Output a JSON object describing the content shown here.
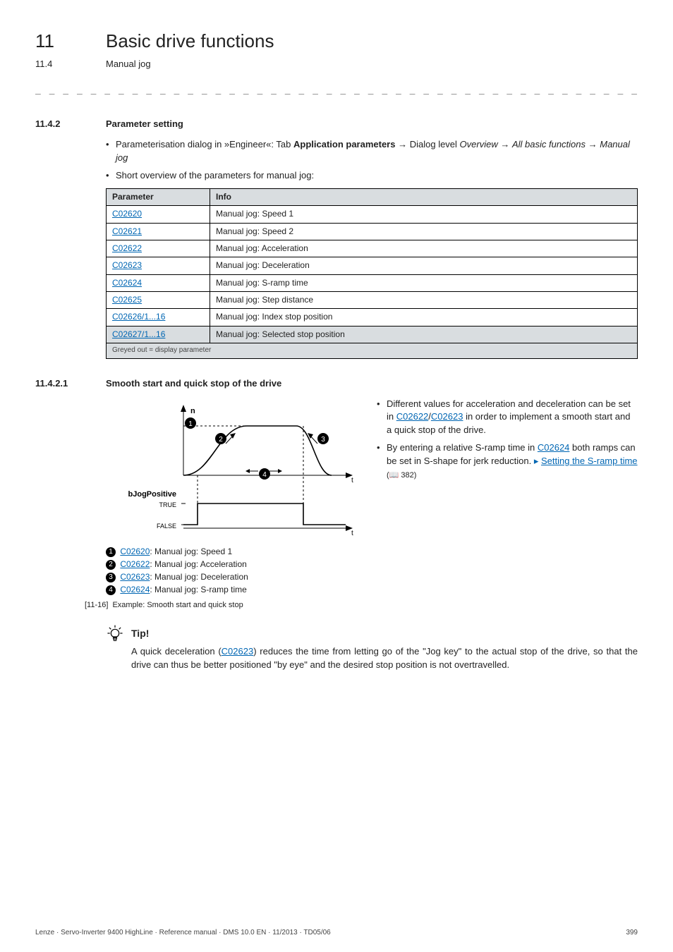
{
  "header": {
    "chapnum": "11",
    "chaptitle": "Basic drive functions",
    "subnum": "11.4",
    "subtitle": "Manual jog"
  },
  "dashline": "_ _ _ _ _ _ _ _ _ _ _ _ _ _ _ _ _ _ _ _ _ _ _ _ _ _ _ _ _ _ _ _ _ _ _ _ _ _ _ _ _ _ _ _ _ _ _ _ _ _ _ _ _ _ _ _ _ _ _ _ _ _ _ _",
  "sec1": {
    "num": "11.4.2",
    "title": "Parameter setting",
    "bullet1a": "Parameterisation dialog in »Engineer«: Tab ",
    "bullet1b": "Application parameters",
    "bullet1c": " Dialog level ",
    "bullet1d": "Overview ",
    "bullet1e": "All basic functions ",
    "bullet1f": " Manual jog",
    "bullet2": "Short overview of the parameters for manual jog:"
  },
  "table": {
    "h1": "Parameter",
    "h2": "Info",
    "rows": [
      {
        "p": "C02620",
        "i": "Manual jog: Speed 1"
      },
      {
        "p": "C02621",
        "i": "Manual jog: Speed 2"
      },
      {
        "p": "C02622",
        "i": "Manual jog: Acceleration"
      },
      {
        "p": "C02623",
        "i": "Manual jog: Deceleration"
      },
      {
        "p": "C02624",
        "i": "Manual jog: S-ramp time"
      },
      {
        "p": "C02625",
        "i": "Manual jog: Step distance"
      },
      {
        "p": "C02626/1...16",
        "i": "Manual jog: Index stop position"
      },
      {
        "p": "C02627/1...16",
        "i": "Manual jog: Selected stop position",
        "grey": true
      }
    ],
    "footnote": "Greyed out = display parameter"
  },
  "sec2": {
    "num": "11.4.2.1",
    "title": "Smooth start and quick stop of the drive"
  },
  "diagram": {
    "n": "n",
    "bJog": "bJogPositive",
    "true": "TRUE",
    "false": "FALSE",
    "t": "t"
  },
  "legend": {
    "l1": {
      "code": "C02620",
      "text": ": Manual jog: Speed 1"
    },
    "l2": {
      "code": "C02622",
      "text": ": Manual jog: Acceleration"
    },
    "l3": {
      "code": "C02623",
      "text": ": Manual jog: Deceleration"
    },
    "l4": {
      "code": "C02624",
      "text": ": Manual jog: S-ramp time"
    }
  },
  "caption": {
    "num": "[11-16]",
    "text": "Example: Smooth start and quick stop"
  },
  "notes": {
    "n1a": "Different values for acceleration and deceleration can be set in ",
    "n1b": "C02622",
    "n1c": "/",
    "n1d": "C02623",
    "n1e": " in order to implement a smooth start and a quick stop of the drive.",
    "n2a": "By entering a relative S-ramp time in ",
    "n2b": "C02624",
    "n2c": " both ramps can be set in S-shape for jerk reduction. ",
    "n2link": "Setting the S-ramp time",
    "n2page": " 382)"
  },
  "tip": {
    "label": "Tip!",
    "body1": "A quick deceleration (",
    "bodylink": "C02623",
    "body2": ") reduces the time from letting go of the \"Jog key\" to the actual stop of the drive, so that the drive can thus be better positioned \"by eye\" and the desired stop position is not overtravelled."
  },
  "footer": {
    "left": "Lenze · Servo-Inverter 9400 HighLine · Reference manual · DMS 10.0 EN · 11/2013 · TD05/06",
    "right": "399"
  }
}
